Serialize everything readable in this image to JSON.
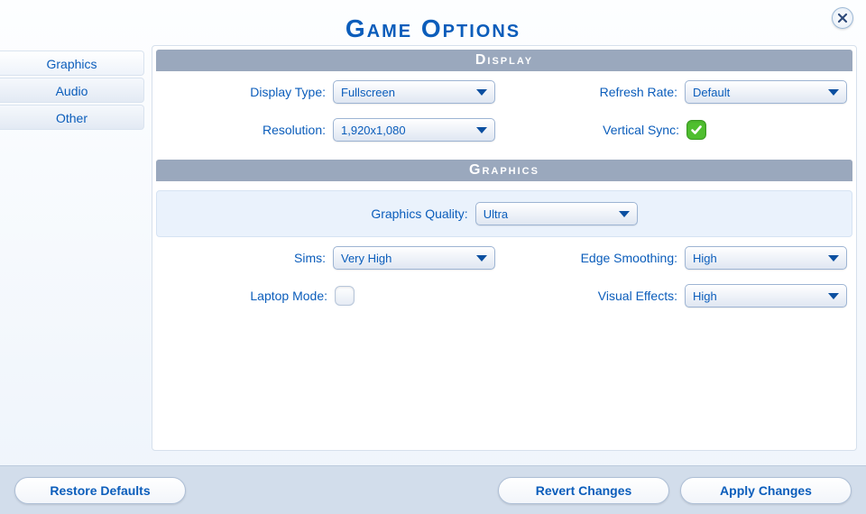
{
  "title": "Game Options",
  "close_icon": "close",
  "sidebar": {
    "tabs": [
      {
        "id": "graphics",
        "label": "Graphics",
        "active": true
      },
      {
        "id": "audio",
        "label": "Audio",
        "active": false
      },
      {
        "id": "other",
        "label": "Other",
        "active": false
      }
    ]
  },
  "sections": {
    "display": {
      "header": "Display",
      "display_type": {
        "label": "Display Type:",
        "value": "Fullscreen"
      },
      "refresh_rate": {
        "label": "Refresh Rate:",
        "value": "Default"
      },
      "resolution": {
        "label": "Resolution:",
        "value": "1,920x1,080"
      },
      "vertical_sync": {
        "label": "Vertical Sync:",
        "checked": true
      }
    },
    "graphics": {
      "header": "Graphics",
      "quality": {
        "label": "Graphics Quality:",
        "value": "Ultra"
      },
      "sims": {
        "label": "Sims:",
        "value": "Very High"
      },
      "edge_smoothing": {
        "label": "Edge Smoothing:",
        "value": "High"
      },
      "laptop_mode": {
        "label": "Laptop Mode:",
        "checked": false
      },
      "visual_effects": {
        "label": "Visual Effects:",
        "value": "High"
      }
    }
  },
  "footer": {
    "restore": "Restore Defaults",
    "revert": "Revert Changes",
    "apply": "Apply Changes"
  }
}
